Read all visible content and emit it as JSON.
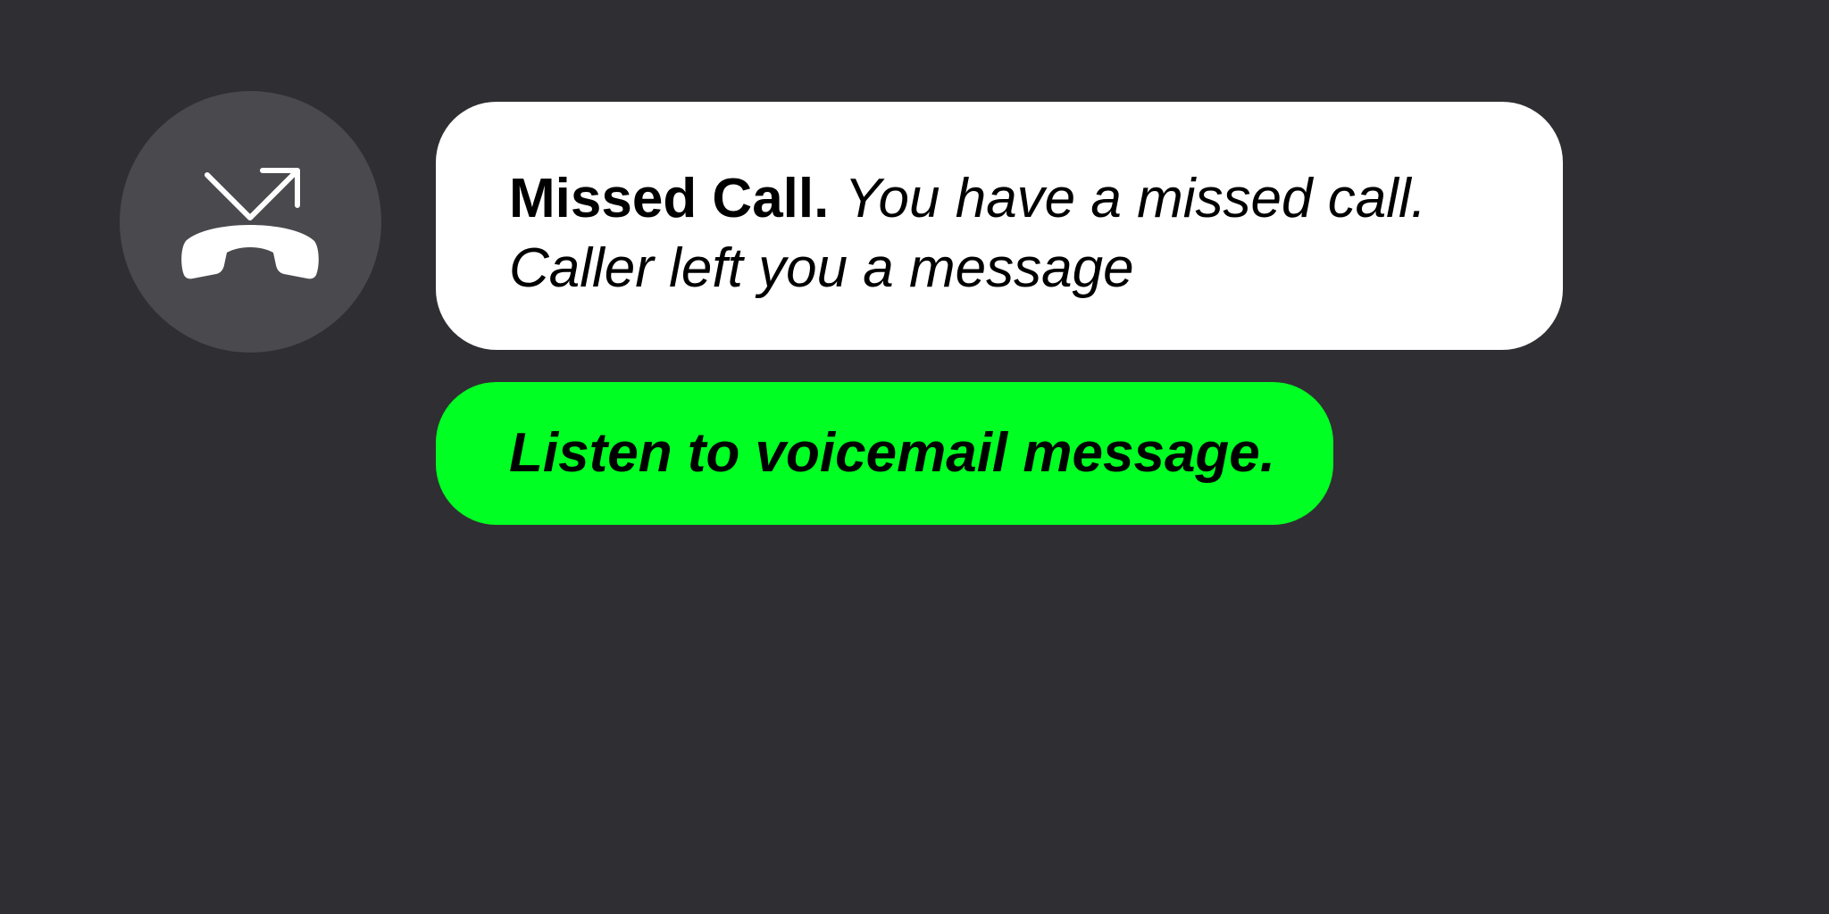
{
  "icon": {
    "name": "missed-call-icon"
  },
  "notification": {
    "title": "Missed Call.",
    "body": "You have a missed call. Caller left you a message"
  },
  "action": {
    "label": "Listen to voicemail message."
  },
  "colors": {
    "background": "#2f2e33",
    "avatar": "#4a494e",
    "card": "#ffffff",
    "accent": "#00ff22"
  }
}
